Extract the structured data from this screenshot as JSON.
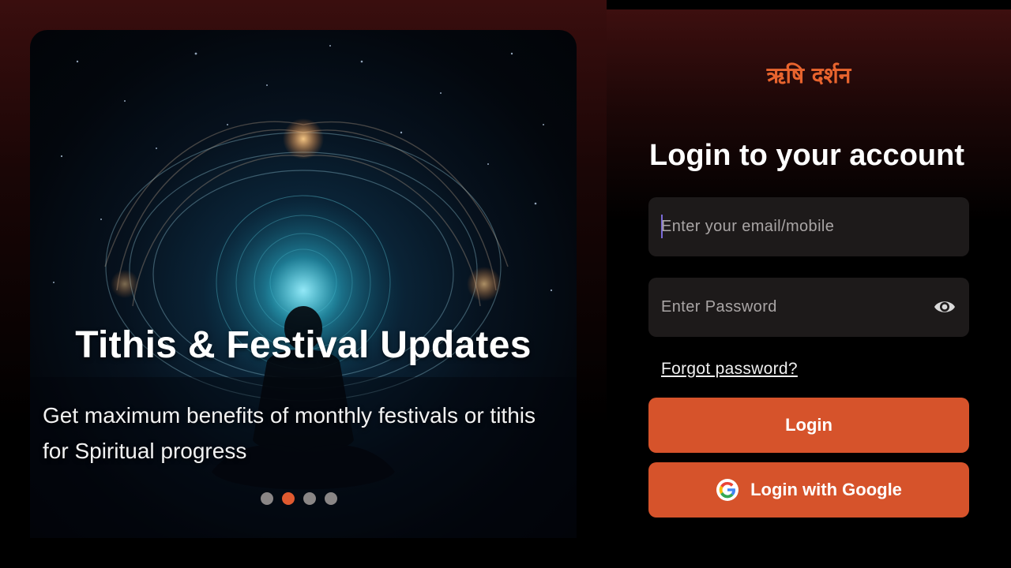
{
  "carousel": {
    "title": "Tithis & Festival Updates",
    "description": "Get maximum benefits of monthly festivals or tithis for Spiritual progress",
    "dots_total": 4,
    "active_dot": 2
  },
  "brand": {
    "logo_text": "ऋषि दर्शन",
    "accent_color": "#e05a30"
  },
  "login": {
    "title": "Login to your account",
    "email_placeholder": "Enter your email/mobile",
    "password_placeholder": "Enter Password",
    "forgot_label": "Forgot password?",
    "login_label": "Login",
    "google_label": "Login with Google"
  },
  "icons": {
    "password_toggle": "eye-icon",
    "google": "google-icon"
  }
}
